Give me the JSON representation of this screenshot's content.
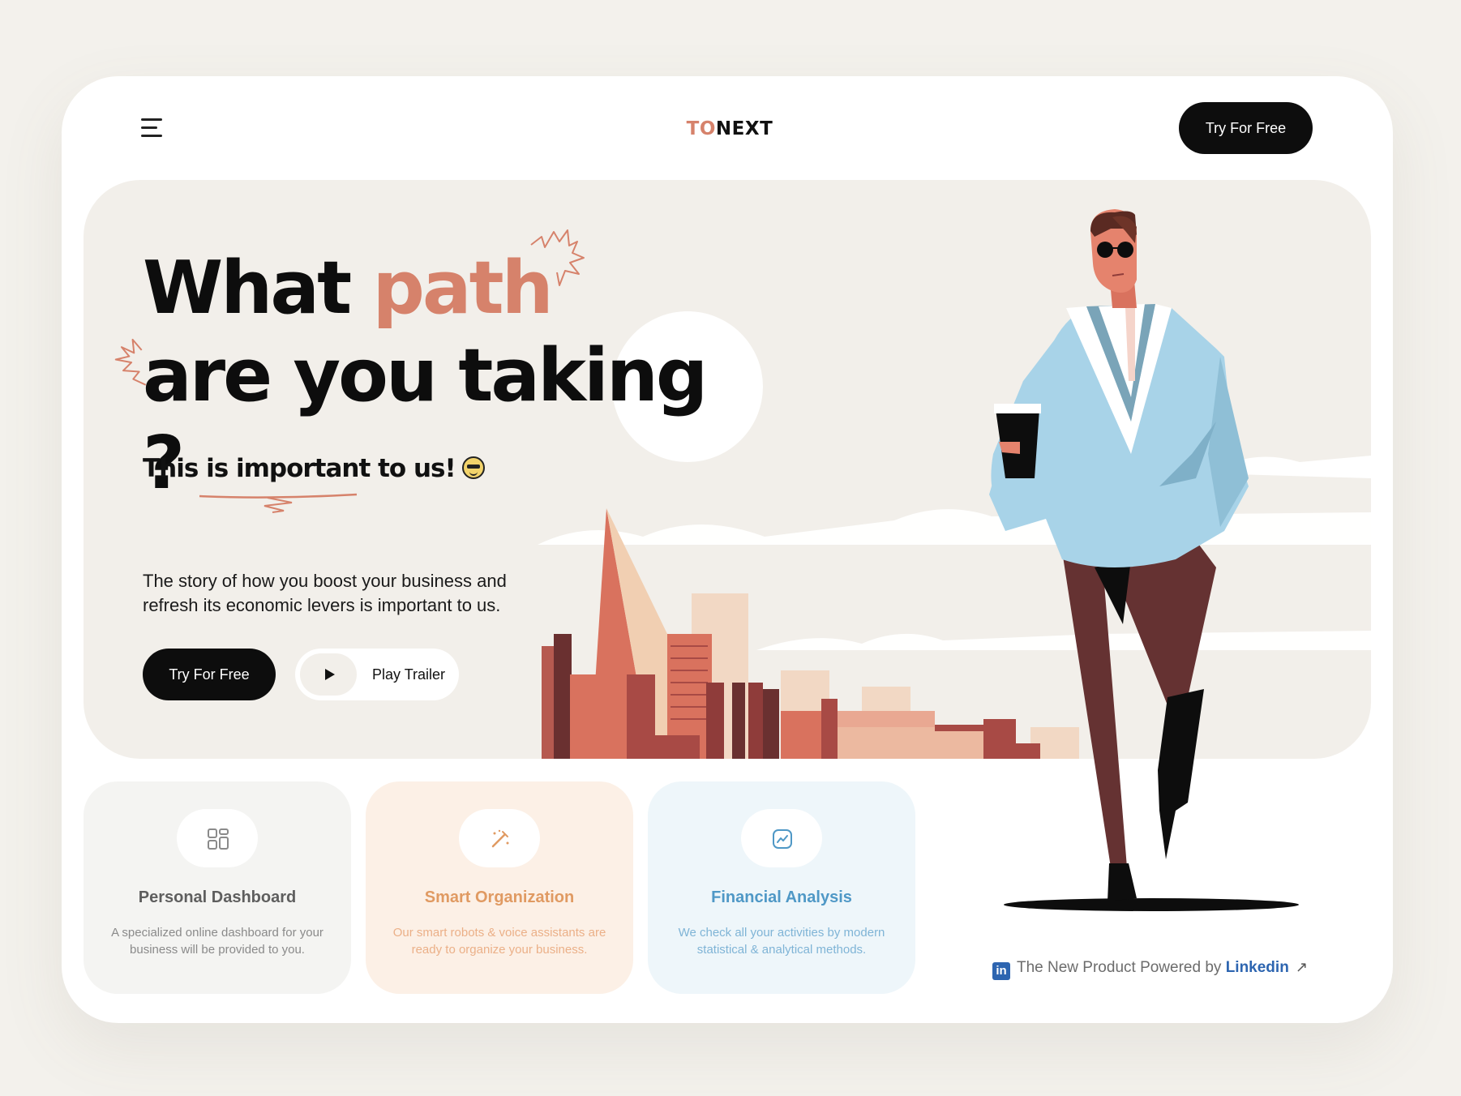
{
  "header": {
    "logo": {
      "part1": "TO",
      "part2": "NEXT"
    },
    "cta_label": "Try For Free",
    "menu_icon": "hamburger-menu-icon"
  },
  "hero": {
    "headline_word1": "What ",
    "headline_accent": "path",
    "headline_line2": "are you taking ?",
    "subheadline": "This is important to us!",
    "description": "The story of how you boost your business and refresh its economic levers is important to us.",
    "primary_cta": "Try For Free",
    "secondary_cta": "Play Trailer"
  },
  "features": [
    {
      "icon": "grid-dashboard-icon",
      "title": "Personal Dashboard",
      "text": "A specialized online dashboard for your business will be provided to you."
    },
    {
      "icon": "magic-wand-icon",
      "title": "Smart Organization",
      "text": "Our smart robots & voice assistants are ready to organize your business."
    },
    {
      "icon": "chart-line-icon",
      "title": "Financial Analysis",
      "text": "We check all your activities by modern statistical & analytical methods."
    }
  ],
  "footer": {
    "powered_text": "The New Product Powered by ",
    "powered_link": "Linkedin"
  },
  "colors": {
    "accent": "#d6826b",
    "dark": "#0d0d0d",
    "hero_bg": "#f2efea",
    "linkedin": "#2d65b0"
  }
}
